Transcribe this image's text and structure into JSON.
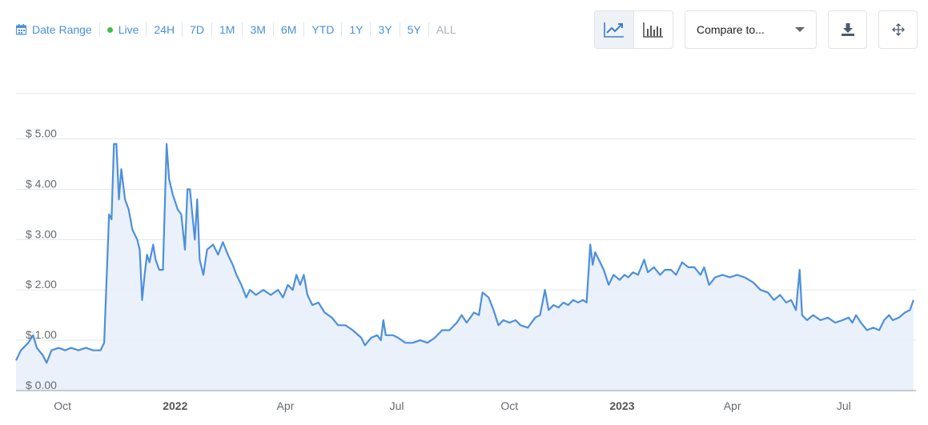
{
  "toolbar": {
    "date_range_label": "Date Range",
    "live_label": "Live",
    "ranges": [
      "24H",
      "7D",
      "1M",
      "3M",
      "6M",
      "YTD",
      "1Y",
      "3Y",
      "5Y",
      "ALL"
    ],
    "disabled_range": "ALL"
  },
  "compare": {
    "label": "Compare to..."
  },
  "colors": {
    "accent": "#4a90d9",
    "line": "#4d8fdb",
    "fill": "#e8f0fb",
    "live": "#3cc14a"
  },
  "chart_data": {
    "type": "area",
    "title": "",
    "xlabel": "",
    "ylabel": "",
    "ylim": [
      0,
      5.9
    ],
    "xlim": [
      "2021-08-24",
      "2023-08-29"
    ],
    "y_ticks": [
      0,
      1,
      2,
      3,
      4,
      5
    ],
    "y_tick_labels": [
      "$ 0.00",
      "$ 1.00",
      "$ 2.00",
      "$ 3.00",
      "$ 4.00",
      "$ 5.00"
    ],
    "x_ticks": [
      {
        "date": "2021-10-01",
        "label": "Oct",
        "bold": false
      },
      {
        "date": "2022-01-01",
        "label": "2022",
        "bold": true
      },
      {
        "date": "2022-04-01",
        "label": "Apr",
        "bold": false
      },
      {
        "date": "2022-07-01",
        "label": "Jul",
        "bold": false
      },
      {
        "date": "2022-10-01",
        "label": "Oct",
        "bold": false
      },
      {
        "date": "2023-01-01",
        "label": "2023",
        "bold": true
      },
      {
        "date": "2023-04-01",
        "label": "Apr",
        "bold": false
      },
      {
        "date": "2023-07-01",
        "label": "Jul",
        "bold": false
      }
    ],
    "grid": true,
    "series": [
      {
        "points": [
          [
            "2021-08-24",
            0.6
          ],
          [
            "2021-08-28",
            0.8
          ],
          [
            "2021-09-03",
            0.95
          ],
          [
            "2021-09-07",
            1.1
          ],
          [
            "2021-09-10",
            0.85
          ],
          [
            "2021-09-15",
            0.7
          ],
          [
            "2021-09-18",
            0.55
          ],
          [
            "2021-09-22",
            0.8
          ],
          [
            "2021-09-28",
            0.85
          ],
          [
            "2021-10-03",
            0.8
          ],
          [
            "2021-10-08",
            0.85
          ],
          [
            "2021-10-14",
            0.8
          ],
          [
            "2021-10-20",
            0.85
          ],
          [
            "2021-10-26",
            0.8
          ],
          [
            "2021-11-01",
            0.8
          ],
          [
            "2021-11-04",
            0.95
          ],
          [
            "2021-11-08",
            3.5
          ],
          [
            "2021-11-10",
            3.4
          ],
          [
            "2021-11-12",
            4.9
          ],
          [
            "2021-11-14",
            4.9
          ],
          [
            "2021-11-16",
            3.8
          ],
          [
            "2021-11-18",
            4.4
          ],
          [
            "2021-11-21",
            3.8
          ],
          [
            "2021-11-24",
            3.6
          ],
          [
            "2021-11-27",
            3.2
          ],
          [
            "2021-12-01",
            3.0
          ],
          [
            "2021-12-03",
            2.8
          ],
          [
            "2021-12-05",
            1.8
          ],
          [
            "2021-12-07",
            2.3
          ],
          [
            "2021-12-09",
            2.7
          ],
          [
            "2021-12-11",
            2.55
          ],
          [
            "2021-12-14",
            2.9
          ],
          [
            "2021-12-16",
            2.6
          ],
          [
            "2021-12-19",
            2.4
          ],
          [
            "2021-12-22",
            2.4
          ],
          [
            "2021-12-25",
            4.9
          ],
          [
            "2021-12-27",
            4.2
          ],
          [
            "2021-12-30",
            3.9
          ],
          [
            "2022-01-03",
            3.6
          ],
          [
            "2022-01-06",
            3.5
          ],
          [
            "2022-01-09",
            2.8
          ],
          [
            "2022-01-11",
            4.0
          ],
          [
            "2022-01-13",
            4.0
          ],
          [
            "2022-01-15",
            3.5
          ],
          [
            "2022-01-17",
            3.0
          ],
          [
            "2022-01-19",
            3.8
          ],
          [
            "2022-01-21",
            2.6
          ],
          [
            "2022-01-24",
            2.3
          ],
          [
            "2022-01-27",
            2.8
          ],
          [
            "2022-02-01",
            2.9
          ],
          [
            "2022-02-05",
            2.7
          ],
          [
            "2022-02-09",
            2.95
          ],
          [
            "2022-02-13",
            2.7
          ],
          [
            "2022-02-17",
            2.5
          ],
          [
            "2022-02-20",
            2.3
          ],
          [
            "2022-02-24",
            2.1
          ],
          [
            "2022-02-28",
            1.85
          ],
          [
            "2022-03-03",
            2.0
          ],
          [
            "2022-03-08",
            1.9
          ],
          [
            "2022-03-14",
            2.0
          ],
          [
            "2022-03-20",
            1.9
          ],
          [
            "2022-03-26",
            2.0
          ],
          [
            "2022-03-30",
            1.85
          ],
          [
            "2022-04-03",
            2.1
          ],
          [
            "2022-04-07",
            2.0
          ],
          [
            "2022-04-10",
            2.3
          ],
          [
            "2022-04-13",
            2.1
          ],
          [
            "2022-04-16",
            2.3
          ],
          [
            "2022-04-19",
            1.9
          ],
          [
            "2022-04-23",
            1.7
          ],
          [
            "2022-04-28",
            1.75
          ],
          [
            "2022-05-03",
            1.55
          ],
          [
            "2022-05-09",
            1.45
          ],
          [
            "2022-05-14",
            1.3
          ],
          [
            "2022-05-20",
            1.3
          ],
          [
            "2022-05-26",
            1.2
          ],
          [
            "2022-06-02",
            1.05
          ],
          [
            "2022-06-05",
            0.9
          ],
          [
            "2022-06-10",
            1.05
          ],
          [
            "2022-06-15",
            1.1
          ],
          [
            "2022-06-18",
            1.0
          ],
          [
            "2022-06-20",
            1.4
          ],
          [
            "2022-06-22",
            1.1
          ],
          [
            "2022-06-28",
            1.1
          ],
          [
            "2022-07-02",
            1.05
          ],
          [
            "2022-07-08",
            0.95
          ],
          [
            "2022-07-14",
            0.95
          ],
          [
            "2022-07-20",
            1.0
          ],
          [
            "2022-07-26",
            0.95
          ],
          [
            "2022-08-01",
            1.05
          ],
          [
            "2022-08-07",
            1.2
          ],
          [
            "2022-08-13",
            1.2
          ],
          [
            "2022-08-19",
            1.35
          ],
          [
            "2022-08-23",
            1.5
          ],
          [
            "2022-08-27",
            1.35
          ],
          [
            "2022-09-02",
            1.55
          ],
          [
            "2022-09-06",
            1.5
          ],
          [
            "2022-09-09",
            1.95
          ],
          [
            "2022-09-14",
            1.85
          ],
          [
            "2022-09-18",
            1.6
          ],
          [
            "2022-09-22",
            1.3
          ],
          [
            "2022-09-26",
            1.4
          ],
          [
            "2022-10-01",
            1.35
          ],
          [
            "2022-10-06",
            1.4
          ],
          [
            "2022-10-10",
            1.3
          ],
          [
            "2022-10-16",
            1.25
          ],
          [
            "2022-10-22",
            1.45
          ],
          [
            "2022-10-26",
            1.5
          ],
          [
            "2022-10-30",
            2.0
          ],
          [
            "2022-11-02",
            1.6
          ],
          [
            "2022-11-06",
            1.7
          ],
          [
            "2022-11-10",
            1.65
          ],
          [
            "2022-11-14",
            1.75
          ],
          [
            "2022-11-18",
            1.7
          ],
          [
            "2022-11-22",
            1.8
          ],
          [
            "2022-11-26",
            1.75
          ],
          [
            "2022-11-30",
            1.8
          ],
          [
            "2022-12-03",
            1.75
          ],
          [
            "2022-12-06",
            2.9
          ],
          [
            "2022-12-08",
            2.5
          ],
          [
            "2022-12-10",
            2.75
          ],
          [
            "2022-12-13",
            2.6
          ],
          [
            "2022-12-17",
            2.4
          ],
          [
            "2022-12-21",
            2.1
          ],
          [
            "2022-12-25",
            2.3
          ],
          [
            "2022-12-30",
            2.2
          ],
          [
            "2023-01-03",
            2.3
          ],
          [
            "2023-01-06",
            2.25
          ],
          [
            "2023-01-10",
            2.35
          ],
          [
            "2023-01-14",
            2.3
          ],
          [
            "2023-01-19",
            2.6
          ],
          [
            "2023-01-22",
            2.35
          ],
          [
            "2023-01-27",
            2.45
          ],
          [
            "2023-02-01",
            2.3
          ],
          [
            "2023-02-05",
            2.4
          ],
          [
            "2023-02-10",
            2.4
          ],
          [
            "2023-02-14",
            2.3
          ],
          [
            "2023-02-19",
            2.55
          ],
          [
            "2023-02-24",
            2.45
          ],
          [
            "2023-03-01",
            2.45
          ],
          [
            "2023-03-06",
            2.3
          ],
          [
            "2023-03-09",
            2.45
          ],
          [
            "2023-03-13",
            2.1
          ],
          [
            "2023-03-18",
            2.25
          ],
          [
            "2023-03-24",
            2.3
          ],
          [
            "2023-03-30",
            2.25
          ],
          [
            "2023-04-05",
            2.3
          ],
          [
            "2023-04-11",
            2.25
          ],
          [
            "2023-04-18",
            2.15
          ],
          [
            "2023-04-24",
            2.0
          ],
          [
            "2023-04-30",
            1.95
          ],
          [
            "2023-05-05",
            1.8
          ],
          [
            "2023-05-10",
            1.9
          ],
          [
            "2023-05-15",
            1.75
          ],
          [
            "2023-05-19",
            1.8
          ],
          [
            "2023-05-23",
            1.6
          ],
          [
            "2023-05-26",
            2.4
          ],
          [
            "2023-05-28",
            1.5
          ],
          [
            "2023-06-01",
            1.4
          ],
          [
            "2023-06-06",
            1.5
          ],
          [
            "2023-06-12",
            1.4
          ],
          [
            "2023-06-18",
            1.45
          ],
          [
            "2023-06-24",
            1.35
          ],
          [
            "2023-06-30",
            1.4
          ],
          [
            "2023-07-05",
            1.45
          ],
          [
            "2023-07-08",
            1.35
          ],
          [
            "2023-07-11",
            1.5
          ],
          [
            "2023-07-15",
            1.35
          ],
          [
            "2023-07-20",
            1.2
          ],
          [
            "2023-07-25",
            1.25
          ],
          [
            "2023-07-30",
            1.2
          ],
          [
            "2023-08-03",
            1.4
          ],
          [
            "2023-08-07",
            1.5
          ],
          [
            "2023-08-10",
            1.4
          ],
          [
            "2023-08-15",
            1.45
          ],
          [
            "2023-08-20",
            1.55
          ],
          [
            "2023-08-24",
            1.6
          ],
          [
            "2023-08-27",
            1.8
          ]
        ]
      }
    ]
  }
}
